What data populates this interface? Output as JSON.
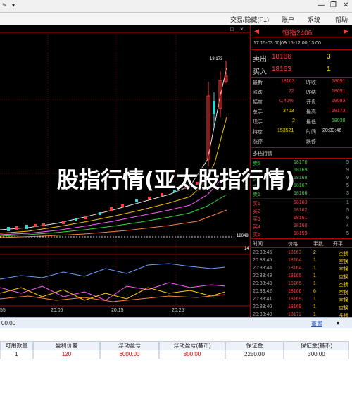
{
  "window": {
    "minimize": "—",
    "restore": "❐",
    "close": "✕"
  },
  "menu": {
    "trade": "交易/隐藏(F1)",
    "account": "账户",
    "system": "系统",
    "help": "帮助"
  },
  "chart": {
    "peak_label": "18,173",
    "price_label_right": "18049",
    "sub_label_right": "14",
    "time_ticks": [
      "55",
      "20:05",
      "20:15",
      "20:25"
    ],
    "close_x": "×",
    "restore_x": "□"
  },
  "panel": {
    "symbol": "恒指2406",
    "sessions": "17:15-03:00|09:15-12:00|13:00",
    "sell_label": "卖出",
    "sell_price": "18166",
    "sell_qty": "3",
    "buy_label": "买入",
    "buy_price": "18163",
    "buy_qty": "1",
    "stats": [
      {
        "l1": "最新",
        "v1": "18163",
        "l2": "昨收",
        "v2": "18091"
      },
      {
        "l1": "涨跌",
        "v1": "72",
        "l2": "昨结",
        "v2": "18091"
      },
      {
        "l1": "幅度",
        "v1": "0.40%",
        "l2": "开盘",
        "v2": "18093"
      },
      {
        "l1": "总手",
        "v1": "3703",
        "l2": "最高",
        "v2": "18173"
      },
      {
        "l1": "现手",
        "v1": "2",
        "l2": "最低",
        "v2": "18038"
      },
      {
        "l1": "持仓",
        "v1": "153521",
        "l2": "时间",
        "v2": "20:33:46"
      },
      {
        "l1": "涨停",
        "v1": "",
        "l2": "跌停",
        "v2": ""
      }
    ],
    "depth_title": "多档行情",
    "depth": [
      {
        "label": "卖5",
        "price": "18170",
        "qty": "5"
      },
      {
        "label": "卖4",
        "price": "18169",
        "qty": "9"
      },
      {
        "label": "卖3",
        "price": "18168",
        "qty": "9"
      },
      {
        "label": "卖2",
        "price": "18167",
        "qty": "5"
      },
      {
        "label": "卖1",
        "price": "18166",
        "qty": "3"
      },
      {
        "label": "买1",
        "price": "18163",
        "qty": "1"
      },
      {
        "label": "买2",
        "price": "18162",
        "qty": "5"
      },
      {
        "label": "买3",
        "price": "18161",
        "qty": "6"
      },
      {
        "label": "买4",
        "price": "18160",
        "qty": "4"
      },
      {
        "label": "买5",
        "price": "18159",
        "qty": "5"
      }
    ],
    "ticks_header": {
      "time": "时间",
      "price": "价格",
      "qty": "手数",
      "type": "开平"
    },
    "ticks": [
      {
        "time": "20:33:45",
        "price": "18163",
        "qty": "2",
        "type": "空换"
      },
      {
        "time": "20:33:45",
        "price": "18164",
        "qty": "1",
        "type": "空换"
      },
      {
        "time": "20:33:44",
        "price": "18164",
        "qty": "1",
        "type": "空换"
      },
      {
        "time": "20:33:43",
        "price": "18165",
        "qty": "1",
        "type": "空换"
      },
      {
        "time": "20:33:43",
        "price": "18165",
        "qty": "1",
        "type": "空换"
      },
      {
        "time": "20:33:42",
        "price": "18166",
        "qty": "6",
        "type": "空换"
      },
      {
        "time": "20:33:41",
        "price": "18169",
        "qty": "1",
        "type": "空换"
      },
      {
        "time": "20:33:40",
        "price": "18169",
        "qty": "1",
        "type": "空换"
      },
      {
        "time": "20:33:40",
        "price": "18172",
        "qty": "1",
        "type": "多换"
      }
    ]
  },
  "status": {
    "left": "00.00",
    "link": "重置"
  },
  "table": {
    "headers": [
      "可用数量",
      "盈利价差",
      "浮动盈亏",
      "浮动盈亏(基币)",
      "保证金",
      "保证金(基币)"
    ],
    "row": [
      "1",
      "120",
      "6000.00",
      "800.00",
      "2250.00",
      "300.00"
    ]
  },
  "overlay": {
    "title": "股指行情(亚太股指行情)"
  }
}
